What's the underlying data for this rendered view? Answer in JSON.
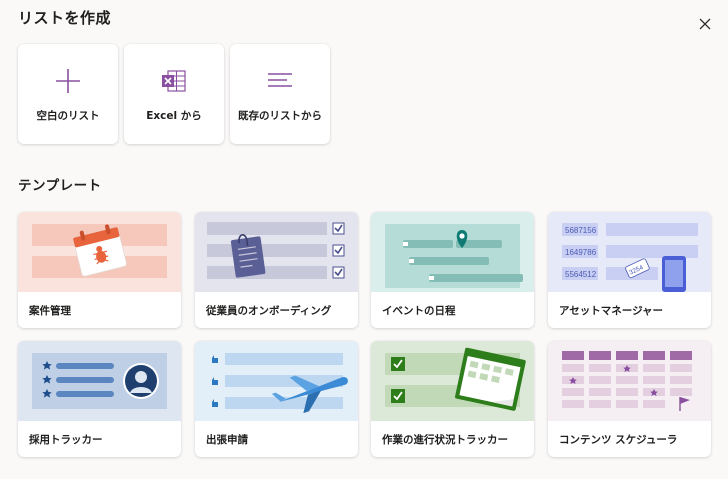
{
  "dialog": {
    "title": "リストを作成"
  },
  "create_options": [
    {
      "label": "空白のリスト",
      "icon": "plus-icon"
    },
    {
      "label": "Excel から",
      "icon": "excel-icon"
    },
    {
      "label": "既存のリストから",
      "icon": "lines-icon"
    }
  ],
  "templates_section": {
    "title": "テンプレート"
  },
  "templates": [
    {
      "label": "案件管理",
      "icon": "calendar-bug-icon"
    },
    {
      "label": "従業員のオンボーディング",
      "icon": "clipboard-checklist-icon"
    },
    {
      "label": "イベントの日程",
      "icon": "map-pin-schedule-icon"
    },
    {
      "label": "アセットマネージャー",
      "icon": "asset-phone-tag-icon"
    },
    {
      "label": "採用トラッカー",
      "icon": "candidate-profile-icon"
    },
    {
      "label": "出張申請",
      "icon": "airplane-icon"
    },
    {
      "label": "作業の進行状況トラッカー",
      "icon": "progress-checklist-icon"
    },
    {
      "label": "コンテンツ スケジューラ",
      "icon": "content-calendar-icon"
    }
  ],
  "asset_numbers": [
    "5687156",
    "1649786",
    "5564512"
  ],
  "asset_tag": "3254",
  "colors": {
    "accent_purple": "#8a4fa1",
    "excel_purple": "#8a4fa1",
    "issue_bg": "#fbe3dd",
    "onboarding_bg": "#e4e4ef",
    "event_bg": "#daeeec",
    "asset_bg": "#e6e9f8",
    "recruit_bg": "#dde6f1",
    "travel_bg": "#e2eef8",
    "progress_bg": "#dde9d8",
    "content_bg": "#f5eef3"
  }
}
